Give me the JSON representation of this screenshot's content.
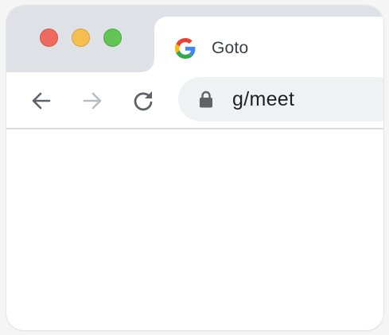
{
  "window": {
    "traffic_lights": [
      {
        "name": "close",
        "color": "#ed6a5e"
      },
      {
        "name": "minimize",
        "color": "#f5bf4f"
      },
      {
        "name": "zoom",
        "color": "#62c554"
      }
    ]
  },
  "tab": {
    "title": "Goto",
    "favicon": "google-g-icon"
  },
  "toolbar": {
    "back_icon": "arrow-left-icon",
    "forward_icon": "arrow-right-icon",
    "reload_icon": "reload-icon"
  },
  "omnibox": {
    "lock_icon": "lock-icon",
    "url": "g/meet"
  },
  "colors": {
    "titlebar": "#dee1e6",
    "omnibox_bg": "#eff1f3",
    "icon_active": "#5f6368",
    "icon_disabled": "#b9bcc0"
  }
}
